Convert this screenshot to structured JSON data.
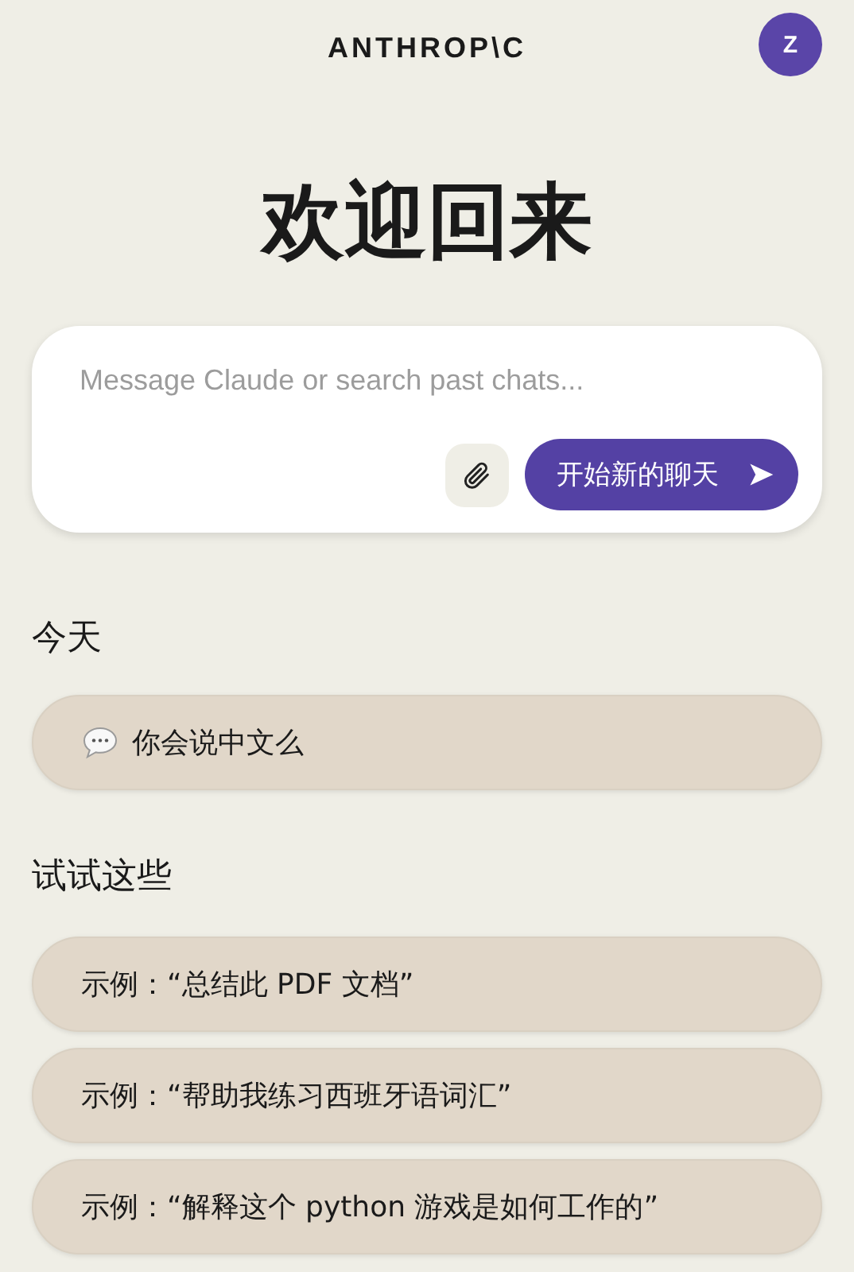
{
  "header": {
    "logo": "ANTHROP\\C",
    "avatar": "Z"
  },
  "title": "欢迎回来",
  "composer": {
    "placeholder": "Message Claude or search past chats...",
    "send_button": "开始新的聊天"
  },
  "recent": {
    "heading": "今天",
    "chats": [
      {
        "title": "你会说中文么"
      }
    ]
  },
  "suggestions": {
    "heading": "试试这些",
    "items": [
      {
        "label": "示例：“总结此 PDF 文档”"
      },
      {
        "label": "示例：“帮助我练习西班牙语词汇”"
      },
      {
        "label": "示例：“解释这个 python 游戏是如何工作的”"
      }
    ]
  }
}
